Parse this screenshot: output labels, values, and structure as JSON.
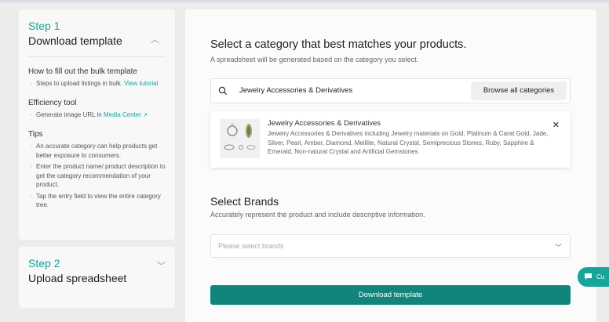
{
  "left_panel": {
    "step1": {
      "number": "Step 1",
      "title": "Download template",
      "how_title": "How to fill out the bulk template",
      "how_text": "Steps to upload listings in bulk.",
      "how_link": "View tutorial",
      "eff_title": "Efficiency tool",
      "eff_text": "Generate image URL in",
      "eff_link": "Media Center",
      "tips_title": "Tips",
      "tips": [
        "An accurate category can help products get better exposure to consumers.",
        "Enter the product name/ product description to get the category recommendation of your product.",
        "Tap the entry field to view the entire category tree."
      ]
    },
    "step2": {
      "number": "Step 2",
      "title": "Upload spreadsheet"
    }
  },
  "main": {
    "heading": "Select a category that best matches your products.",
    "subheading": "A spreadsheet will be generated based on the category you select.",
    "search_value": "Jewelry Accessories & Derivatives",
    "browse_label": "Browse all categories",
    "result": {
      "title": "Jewelry Accessories & Derivatives",
      "description": "Jewelry Accessories & Derivatives including Jewelry materials on Gold, Platinum & Carat Gold, Jade, Silver, Pearl, Amber, Diamond, Meillite, Natural Crystal, Semiprecious Stones, Ruby, Sapphire & Emerald, Non-natural Crystal and Artificial Gemstones",
      "close_icon": "close-icon"
    },
    "brands_heading": "Select Brands",
    "brands_sub": "Accurately represent the product and include descriptive information.",
    "brands_placeholder": "Please select brands",
    "download_label": "Download template"
  },
  "chat": {
    "label": "Cu"
  },
  "colors": {
    "accent": "#14a39a",
    "button": "#11857b"
  }
}
